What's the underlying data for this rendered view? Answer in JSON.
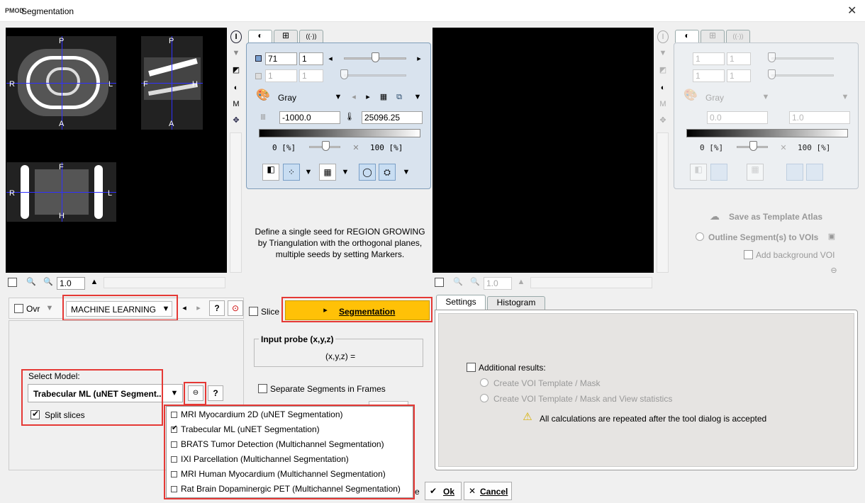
{
  "window": {
    "title": "Segmentation",
    "logo": "PMOD"
  },
  "left_viewer": {
    "transverse_labels": {
      "top": "P",
      "bottom": "A",
      "left": "R",
      "right": "L"
    },
    "sagittal_labels": {
      "top": "P",
      "bottom": "A",
      "left": "F",
      "right": "H"
    },
    "coronal_labels": {
      "top": "F",
      "bottom": "H",
      "left": "R",
      "right": "L"
    },
    "zoom_value": "1.0"
  },
  "left_controls": {
    "tabs": [
      "◐",
      "⊞",
      "((·))"
    ],
    "slice_value": "71",
    "slice_step": "1",
    "frame_value": "1",
    "frame_step": "1",
    "colormap": "Gray",
    "min_value": "-1000.0",
    "max_value": "25096.25",
    "pct_min": "0 [%]",
    "pct_max": "100 [%]"
  },
  "hint_text": "Define a single seed for REGION GROWING by Triangulation with the orthogonal planes, multiple seeds by setting Markers.",
  "right_viewer": {
    "zoom_value": "1.0"
  },
  "right_controls": {
    "slice_value": "1",
    "slice_step": "1",
    "frame_value": "1",
    "frame_step": "1",
    "colormap": "Gray",
    "min_value": "0.0",
    "max_value": "1.0",
    "pct_min": "0 [%]",
    "pct_max": "100 [%]"
  },
  "template": {
    "save_atlas": "Save as Template Atlas",
    "outline": "Outline Segment(s) to VOIs",
    "add_background": "Add background VOI"
  },
  "method": {
    "ovr_label": "Ovr",
    "selected": "MACHINE LEARNING",
    "help": "?"
  },
  "model": {
    "label": "Select Model:",
    "selected": "Trabecular ML (uNET Segment...",
    "split_slices": "Split slices",
    "help": "?"
  },
  "model_options": [
    {
      "label": "MRI Myocardium 2D (uNET Segmentation)",
      "checked": false
    },
    {
      "label": "Trabecular ML (uNET Segmentation)",
      "checked": true
    },
    {
      "label": "BRATS Tumor Detection (Multichannel Segmentation)",
      "checked": false
    },
    {
      "label": "IXI Parcellation (Multichannel Segmentation)",
      "checked": false
    },
    {
      "label": "MRI Human Myocardium (Multichannel Segmentation)",
      "checked": false
    },
    {
      "label": "Rat Brain Dopaminergic PET (Multichannel Segmentation)",
      "checked": false
    }
  ],
  "middle": {
    "slice_label": "Slice",
    "segment_button": "Segmentation",
    "probe_title": "Input probe (x,y,z)",
    "probe_value": "(x,y,z) =",
    "separate_frames": "Separate Segments in Frames"
  },
  "result_tabs": [
    "Settings",
    "Histogram"
  ],
  "settings": {
    "additional": "Additional results:",
    "opt1": "Create VOI Template / Mask",
    "opt2": "Create VOI Template / Mask and View statistics",
    "warning": "All calculations are repeated after the tool dialog is accepted"
  },
  "footer": {
    "ok": "Ok",
    "cancel": "Cancel",
    "partial": "e"
  },
  "colors": {
    "highlight": "#e53935",
    "segment_button": "#ffc107",
    "axis": "#3030ff"
  }
}
